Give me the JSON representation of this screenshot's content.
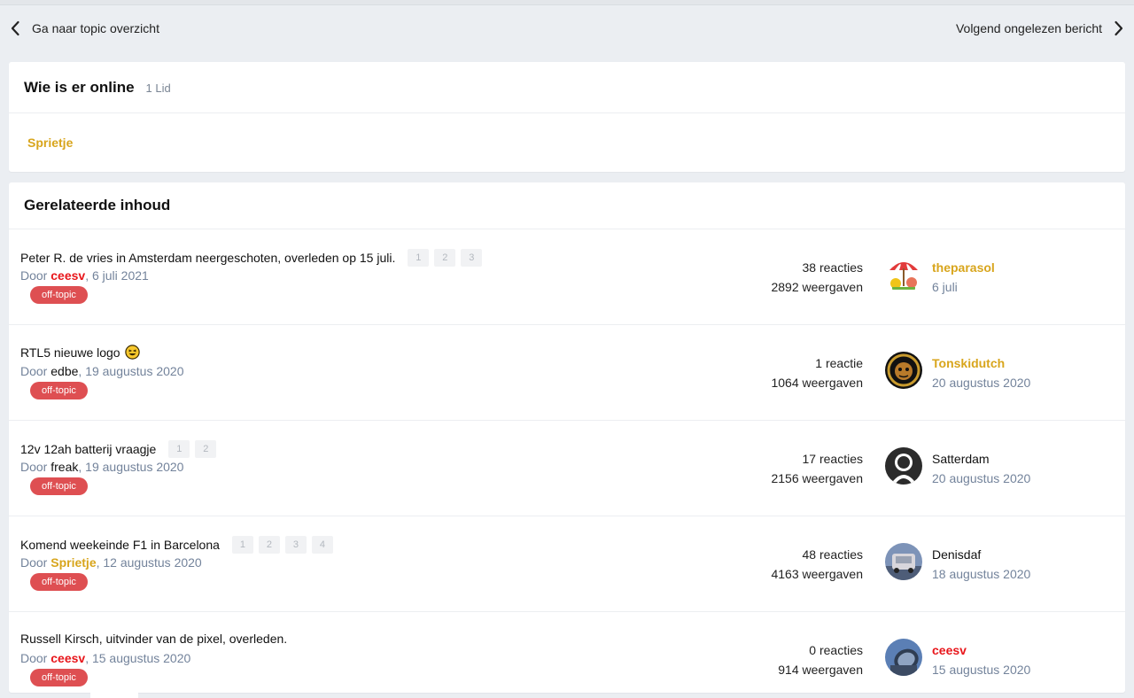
{
  "pager": {
    "prev_label": "Ga naar topic overzicht",
    "next_label": "Volgend ongelezen bericht"
  },
  "online": {
    "title": "Wie is er online",
    "count": "1 Lid",
    "users": [
      "Sprietje"
    ]
  },
  "related": {
    "title": "Gerelateerde inhoud",
    "by_prefix": "Door",
    "topics": [
      {
        "title": "Peter R. de vries in Amsterdam neergeschoten, overleden op 15 juli.",
        "pages": [
          "1",
          "2",
          "3"
        ],
        "author": "ceesv",
        "date": "6 juli 2021",
        "tag": "off-topic",
        "replies": "38 reacties",
        "views": "2892 weergaven",
        "last_user": "theparasol",
        "last_date": "6 juli"
      },
      {
        "title": "RTL5 nieuwe logo",
        "pages": [],
        "author": "edbe",
        "date": "19 augustus 2020",
        "tag": "off-topic",
        "replies": "1 reactie",
        "views": "1064 weergaven",
        "last_user": "Tonskidutch",
        "last_date": "20 augustus 2020"
      },
      {
        "title": "12v 12ah batterij vraagje",
        "pages": [
          "1",
          "2"
        ],
        "author": "freak",
        "date": "19 augustus 2020",
        "tag": "off-topic",
        "replies": "17 reacties",
        "views": "2156 weergaven",
        "last_user": "Satterdam",
        "last_date": "20 augustus 2020"
      },
      {
        "title": "Komend weekeinde F1 in Barcelona",
        "pages": [
          "1",
          "2",
          "3",
          "4"
        ],
        "author": "Sprietje",
        "date": "12 augustus 2020",
        "tag": "off-topic",
        "replies": "48 reacties",
        "views": "4163 weergaven",
        "last_user": "Denisdaf",
        "last_date": "18 augustus 2020"
      },
      {
        "title": "Russell Kirsch, uitvinder van de pixel, overleden.",
        "pages": [],
        "author": "ceesv",
        "date": "15 augustus 2020",
        "tag": "off-topic",
        "replies": "0 reacties",
        "views": "914 weergaven",
        "last_user": "ceesv",
        "last_date": "15 augustus 2020"
      }
    ]
  },
  "colors": {
    "background": "#ebeef2",
    "gold_user": "#d8a51c",
    "red_user": "#e8161b",
    "tag": "#de4f52",
    "muted": "#73839b"
  }
}
